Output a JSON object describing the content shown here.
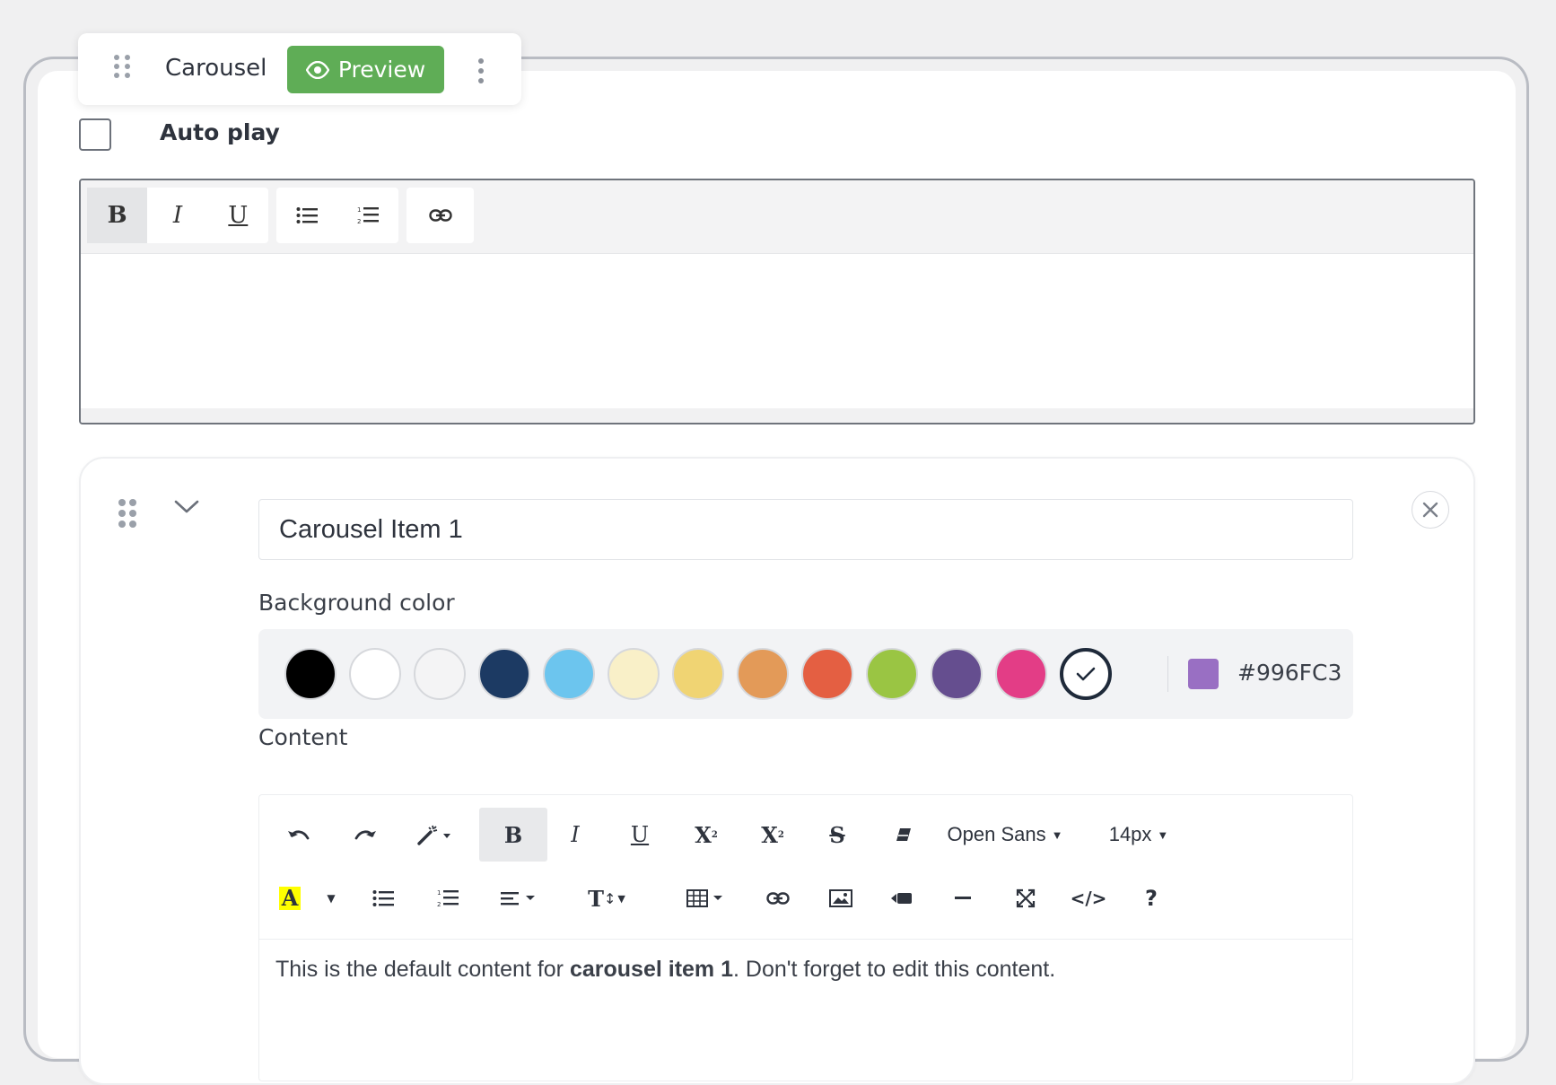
{
  "block": {
    "title": "Carousel",
    "preview_label": "Preview",
    "preview_color": "#5fad56"
  },
  "autoplay": {
    "label": "Auto play",
    "checked": false
  },
  "editor1": {
    "buttons": [
      "B",
      "I",
      "U",
      "bullet-list-icon",
      "numbered-list-icon",
      "link-icon"
    ],
    "content": ""
  },
  "item": {
    "title_value": "Carousel Item 1",
    "bg_label": "Background color",
    "swatches": [
      "#000000",
      "#ffffff",
      "#f4f4f5",
      "#1c3a63",
      "#6cc5ee",
      "#f9f0c8",
      "#f0d473",
      "#e39a58",
      "#e45f42",
      "#9ac543",
      "#654e8f",
      "#e33d86",
      "selected"
    ],
    "custom_color": "#996FC3",
    "custom_hex": "#996FC3",
    "content_label": "Content",
    "toolbar": {
      "font_name": "Open Sans",
      "font_size": "14px",
      "buttons_row1": [
        "undo-icon",
        "redo-icon",
        "magic-icon",
        "bold",
        "italic",
        "underline",
        "superscript",
        "subscript",
        "strikethrough",
        "eraser-icon"
      ],
      "buttons_row2": [
        "highlight-icon",
        "bullet-list-icon",
        "numbered-list-icon",
        "align-icon",
        "text-size-icon",
        "table-icon",
        "link-icon",
        "image-icon",
        "video-icon",
        "hr-icon",
        "fullscreen-icon",
        "code-view-icon",
        "help-icon"
      ],
      "code_label": "</>",
      "help_label": "?"
    },
    "content_before": "This is the default content for ",
    "content_bold": "carousel item 1",
    "content_after": ". Don't forget to edit this content."
  }
}
